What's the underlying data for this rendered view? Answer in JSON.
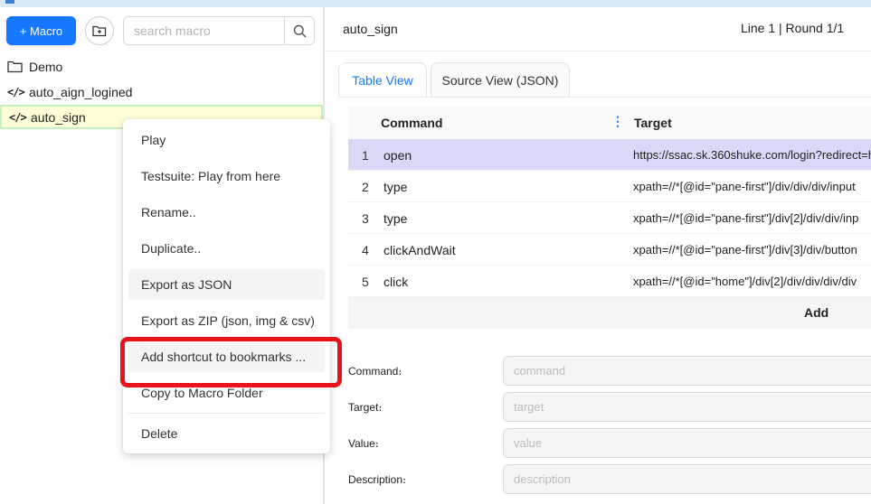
{
  "sidebar": {
    "new_macro_label": "+ Macro",
    "search_placeholder": "search macro",
    "tree": [
      {
        "label": "Demo",
        "icon": "folder-icon"
      },
      {
        "label": "auto_aign_logined",
        "icon": "code-icon"
      },
      {
        "label": "auto_sign",
        "icon": "code-icon"
      }
    ]
  },
  "context_menu": {
    "items": [
      "Play",
      "Testsuite: Play from here",
      "Rename..",
      "Duplicate..",
      "Export as JSON",
      "Export as ZIP (json, img & csv)",
      "Add shortcut to bookmarks ...",
      "Copy to Macro Folder",
      "Delete"
    ],
    "highlight_color": "#e8131b"
  },
  "editor": {
    "macro_name": "auto_sign",
    "status": "Line 1 | Round 1/1",
    "tabs": [
      "Table View",
      "Source View (JSON)"
    ],
    "columns": {
      "command": "Command",
      "target": "Target"
    },
    "rows": [
      {
        "n": "1",
        "command": "open",
        "target": "https://ssac.sk.360shuke.com/login?redirect=h"
      },
      {
        "n": "2",
        "command": "type",
        "target": "xpath=//*[@id=\"pane-first\"]/div/div/div/input"
      },
      {
        "n": "3",
        "command": "type",
        "target": "xpath=//*[@id=\"pane-first\"]/div[2]/div/div/inp"
      },
      {
        "n": "4",
        "command": "clickAndWait",
        "target": "xpath=//*[@id=\"pane-first\"]/div[3]/div/button"
      },
      {
        "n": "5",
        "command": "click",
        "target": "xpath=//*[@id=\"home\"]/div[2]/div/div/div/div"
      }
    ],
    "add_label": "Add",
    "form": {
      "command": {
        "label": "Command։",
        "placeholder": "command"
      },
      "target": {
        "label": "Target։",
        "placeholder": "target"
      },
      "value": {
        "label": "Value։",
        "placeholder": "value"
      },
      "description": {
        "label": "Description։",
        "placeholder": "description"
      }
    },
    "accent": "#1677ff"
  }
}
